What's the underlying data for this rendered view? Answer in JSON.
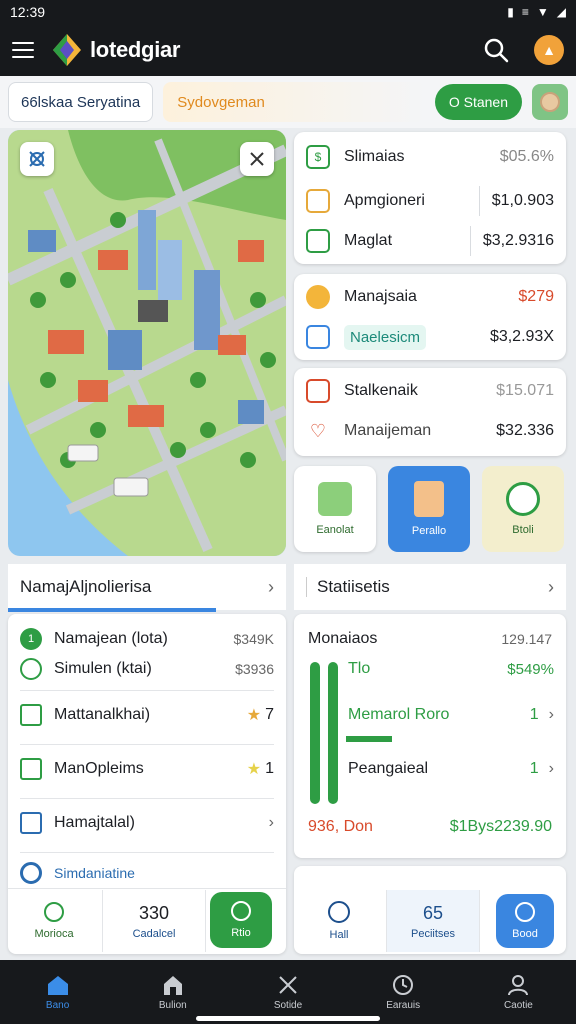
{
  "status_bar": {
    "time": "12:39",
    "icons": [
      "battery-icon",
      "vibrate-icon",
      "wifi-icon",
      "signal-icon"
    ]
  },
  "app_bar": {
    "title": "lotedgiar"
  },
  "filters": {
    "left_chip": "66lskaa  Seryatina",
    "mid_chip": "Sydovgeman",
    "green_chip": "O Stanen"
  },
  "summary_card": {
    "title": "Slimaias",
    "title_value": "$05.6%",
    "rows": [
      {
        "label": "Apmgioneri",
        "value": "$1,0.903"
      },
      {
        "label": "Maglat",
        "value": "$3,2.9316"
      }
    ]
  },
  "manage_card": {
    "rows": [
      {
        "label": "Manajsaia",
        "value": "$279"
      },
      {
        "label": "Naelesicm",
        "value": "$3,2.93X"
      }
    ]
  },
  "stats_card": {
    "rows": [
      {
        "label": "Stalkenaik",
        "value": "$15.071"
      },
      {
        "label": "Manaijeman",
        "value": "$32.336"
      }
    ]
  },
  "tiles": [
    {
      "label": "Eanolat"
    },
    {
      "label": "Perallo"
    },
    {
      "label": "Btoli"
    }
  ],
  "left_panel": {
    "header": "NamajAljnolierisa",
    "items": [
      {
        "label": "Namajean (lota)",
        "value": "$349K"
      },
      {
        "label": "Simulen (ktai)",
        "value": "$3936"
      },
      {
        "label": "Mattanalkhai)",
        "value": "7"
      },
      {
        "label": "ManOpleims",
        "value": "1"
      },
      {
        "label": "Hamajtalal)",
        "value": ""
      },
      {
        "label": "Simdaniatine",
        "value": ""
      }
    ],
    "footer": [
      {
        "label": "Morioca",
        "value": ""
      },
      {
        "label": "Cadalcel",
        "value": "330"
      },
      {
        "label": "Rtio",
        "value": ""
      }
    ]
  },
  "right_panel": {
    "header": "Statiisetis",
    "title": "Monaiaos",
    "title_value": "129.147",
    "items": [
      {
        "label": "Tlo",
        "value": "$549%"
      },
      {
        "label": "Memarol Roro",
        "value": "1"
      },
      {
        "label": "Peangaieal",
        "value": "1"
      }
    ],
    "total_left": "936, Don",
    "total_right": "$1Bys2239.90",
    "footer": [
      {
        "label": "Hall",
        "value": ""
      },
      {
        "label": "Peciitses",
        "value": "65"
      },
      {
        "label": "Bood",
        "value": ""
      }
    ]
  },
  "bottom_nav": [
    {
      "label": "Bano",
      "icon": "home-icon"
    },
    {
      "label": "Bulion",
      "icon": "building-icon"
    },
    {
      "label": "Sotide",
      "icon": "tools-icon"
    },
    {
      "label": "Earauis",
      "icon": "clock-icon"
    },
    {
      "label": "Caotie",
      "icon": "profile-icon"
    }
  ],
  "colors": {
    "accent": "#2e9d44",
    "blue": "#3a86e0",
    "dark": "#17191c",
    "orange": "#e08a1e",
    "red": "#d84a2b"
  }
}
